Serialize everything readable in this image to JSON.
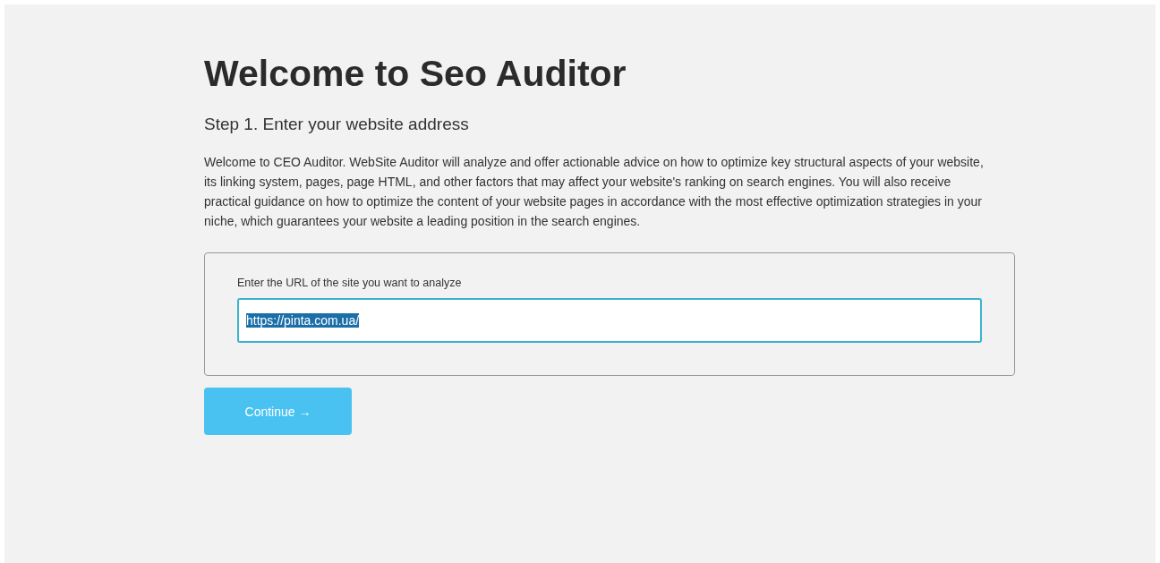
{
  "title": "Welcome to Seo Auditor",
  "step": "Step 1. Enter your website address",
  "description": "Welcome to CEO Auditor. WebSite Auditor will analyze and offer actionable advice on how to optimize key structural aspects of your website, its linking system, pages, page HTML, and other factors that may affect your website's ranking on search engines. You will also receive practical guidance on how to optimize the content of your website pages in accordance with the most effective optimization strategies in your niche, which guarantees your website a leading position in the search engines.",
  "url_field": {
    "label": "Enter the URL of the site you want to analyze",
    "value": "https://pinta.com.ua/",
    "selected": true
  },
  "continue_button": "Continue →"
}
